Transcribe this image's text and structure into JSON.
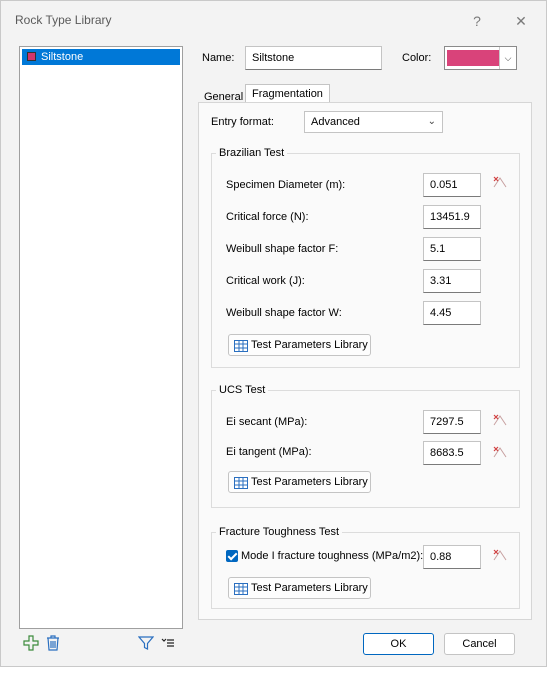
{
  "window": {
    "title": "Rock Type Library",
    "help": "?",
    "close": "✕"
  },
  "rock_list": {
    "items": [
      {
        "label": "Siltstone",
        "color": "#d0366c",
        "selected": true
      }
    ]
  },
  "toolbar": {
    "add_icon": "add-icon",
    "delete_icon": "delete-icon",
    "filter_icon": "filter-icon",
    "menu_icon": "menu-icon"
  },
  "name_field": {
    "label": "Name:",
    "value": "Siltstone"
  },
  "color_field": {
    "label": "Color:",
    "value": "#d9437a"
  },
  "tabs": [
    {
      "label": "General",
      "active": false
    },
    {
      "label": "Fragmentation",
      "active": true
    }
  ],
  "entry_format": {
    "label": "Entry format:",
    "value": "Advanced"
  },
  "brazilian": {
    "title": "Brazilian Test",
    "rows": [
      {
        "label": "Specimen Diameter (m):",
        "value": "0.051"
      },
      {
        "label": "Critical force (N):",
        "value": "13451.9"
      },
      {
        "label": "Weibull shape factor F:",
        "value": "5.1"
      },
      {
        "label": "Critical work (J):",
        "value": "3.31"
      },
      {
        "label": "Weibull shape factor W:",
        "value": "4.45"
      }
    ],
    "button": "Test Parameters Library"
  },
  "ucs": {
    "title": "UCS Test",
    "rows": [
      {
        "label": "Ei secant (MPa):",
        "value": "7297.5"
      },
      {
        "label": "Ei tangent (MPa):",
        "value": "8683.5"
      }
    ],
    "button": "Test Parameters Library"
  },
  "fracture": {
    "title": "Fracture Toughness Test",
    "checkbox_label": "Mode I fracture toughness (MPa/m2):",
    "checked": true,
    "value": "0.88",
    "button": "Test Parameters Library"
  },
  "footer": {
    "ok": "OK",
    "cancel": "Cancel"
  }
}
